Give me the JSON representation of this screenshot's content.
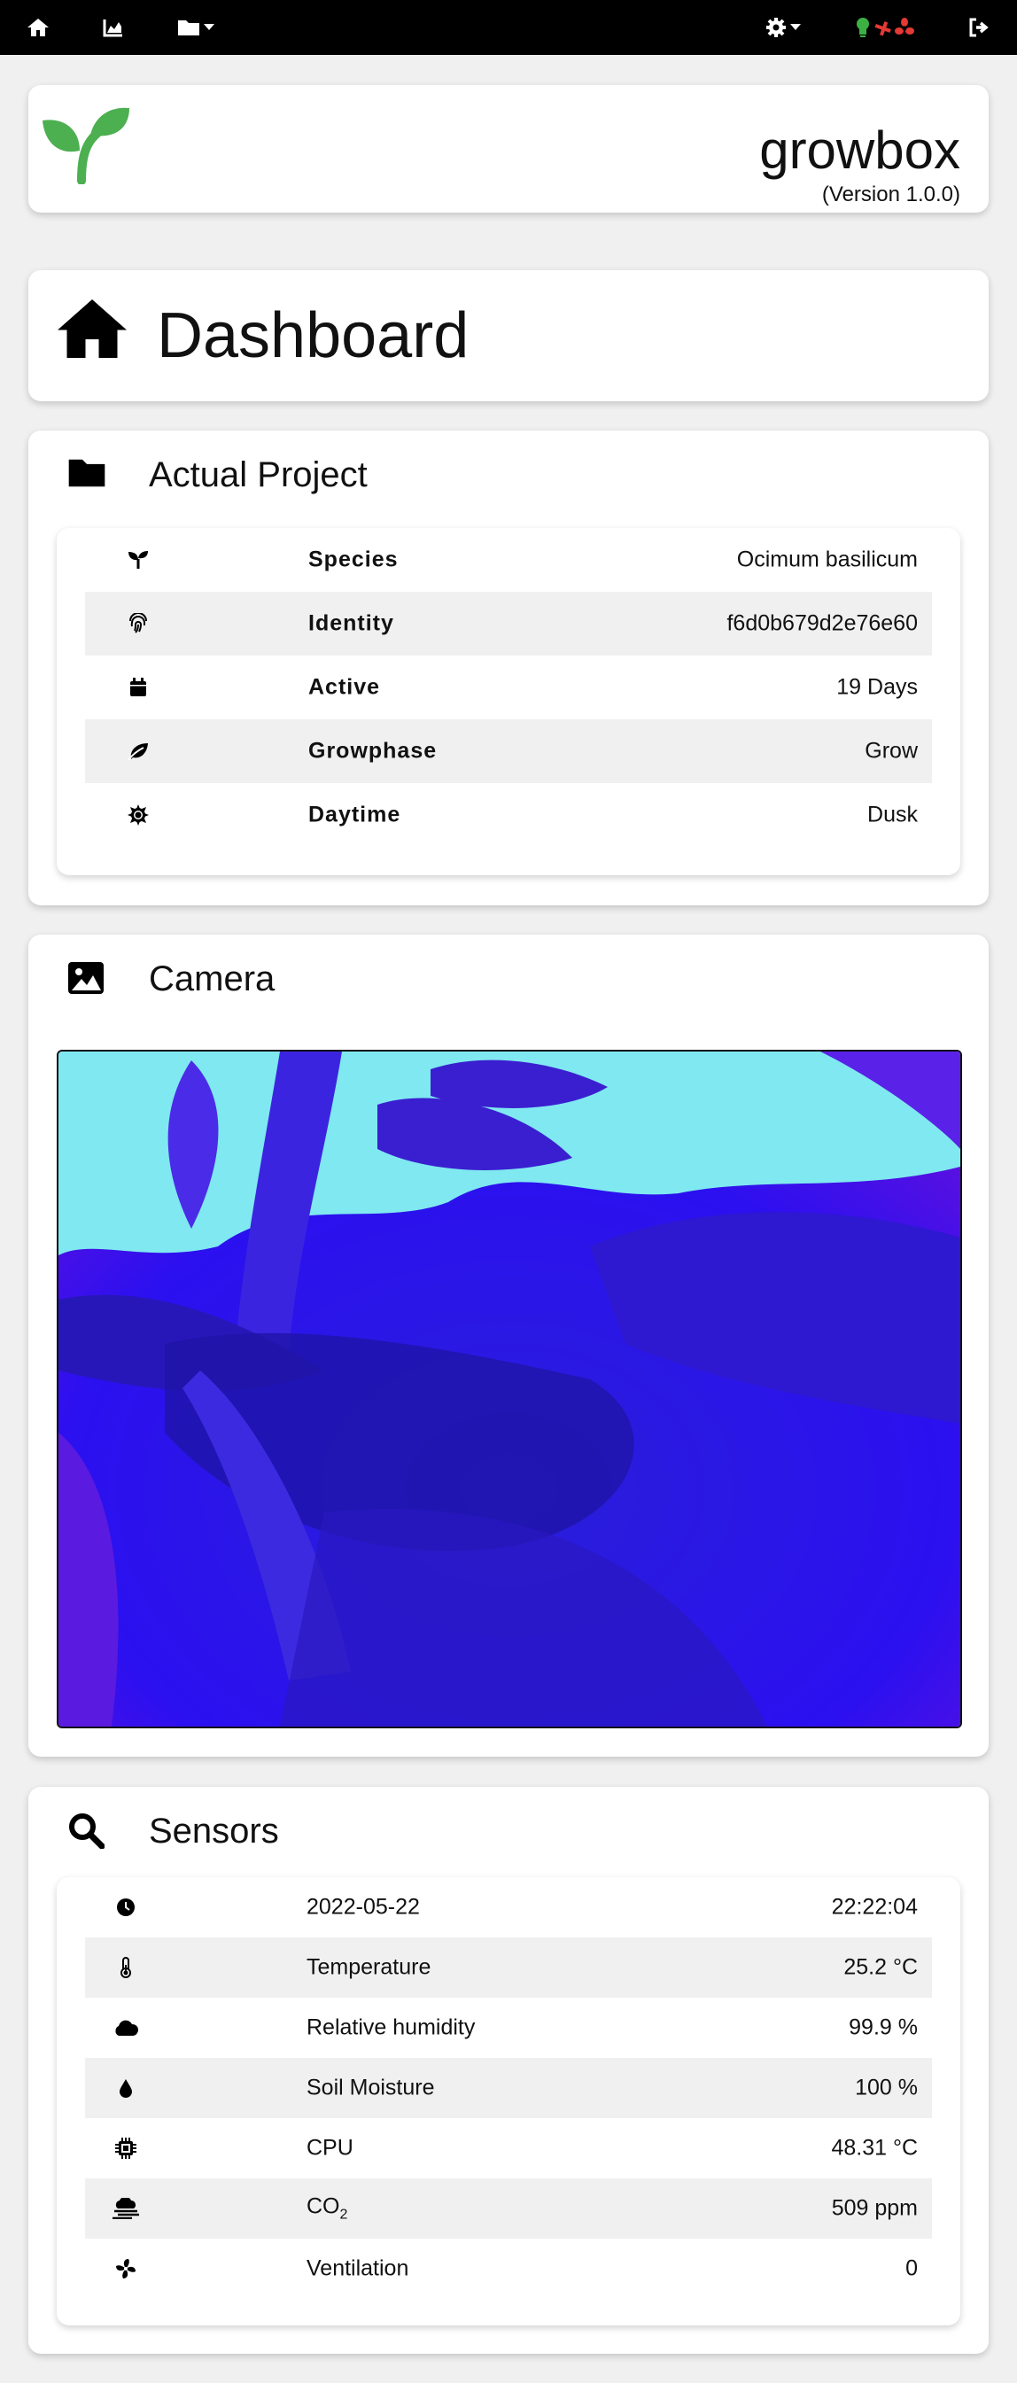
{
  "nav": {
    "home": "home-icon",
    "charts": "chart-area-icon",
    "folder": "folder-icon",
    "settings": "gear-icon",
    "status_light": "lightbulb-icon",
    "status_pump": "pump-icon",
    "status_fan": "fan-icon",
    "logout": "logout-icon",
    "status_colors": {
      "light": "#3cb043",
      "pump": "#e53935",
      "fan": "#e53935"
    }
  },
  "header": {
    "name": "growbox",
    "version": "(Version 1.0.0)",
    "logo_color": "#4caf50"
  },
  "dashboard": {
    "title": "Dashboard"
  },
  "project": {
    "title": "Actual Project",
    "rows": [
      {
        "icon": "seedling-icon",
        "label": "Species",
        "value": "Ocimum basilicum"
      },
      {
        "icon": "fingerprint-icon",
        "label": "Identity",
        "value": "f6d0b679d2e76e60"
      },
      {
        "icon": "calendar-icon",
        "label": "Active",
        "value": "19 Days"
      },
      {
        "icon": "leaf-icon",
        "label": "Growphase",
        "value": "Grow"
      },
      {
        "icon": "sun-icon",
        "label": "Daytime",
        "value": "Dusk"
      }
    ]
  },
  "camera": {
    "title": "Camera"
  },
  "sensors": {
    "title": "Sensors",
    "rows": [
      {
        "icon": "clock-icon",
        "label": "2022-05-22",
        "value": "22:22:04"
      },
      {
        "icon": "thermometer-icon",
        "label": "Temperature",
        "value": "25.2 °C"
      },
      {
        "icon": "cloud-icon",
        "label": "Relative humidity",
        "value": "99.9 %"
      },
      {
        "icon": "droplet-icon",
        "label": "Soil Moisture",
        "value": "100 %"
      },
      {
        "icon": "cpu-icon",
        "label": "CPU",
        "value": "48.31 °C"
      },
      {
        "icon": "smog-icon",
        "label": "CO",
        "label_sub": "2",
        "value": "509 ppm"
      },
      {
        "icon": "fan-icon",
        "label": "Ventilation",
        "value": "0"
      }
    ]
  }
}
